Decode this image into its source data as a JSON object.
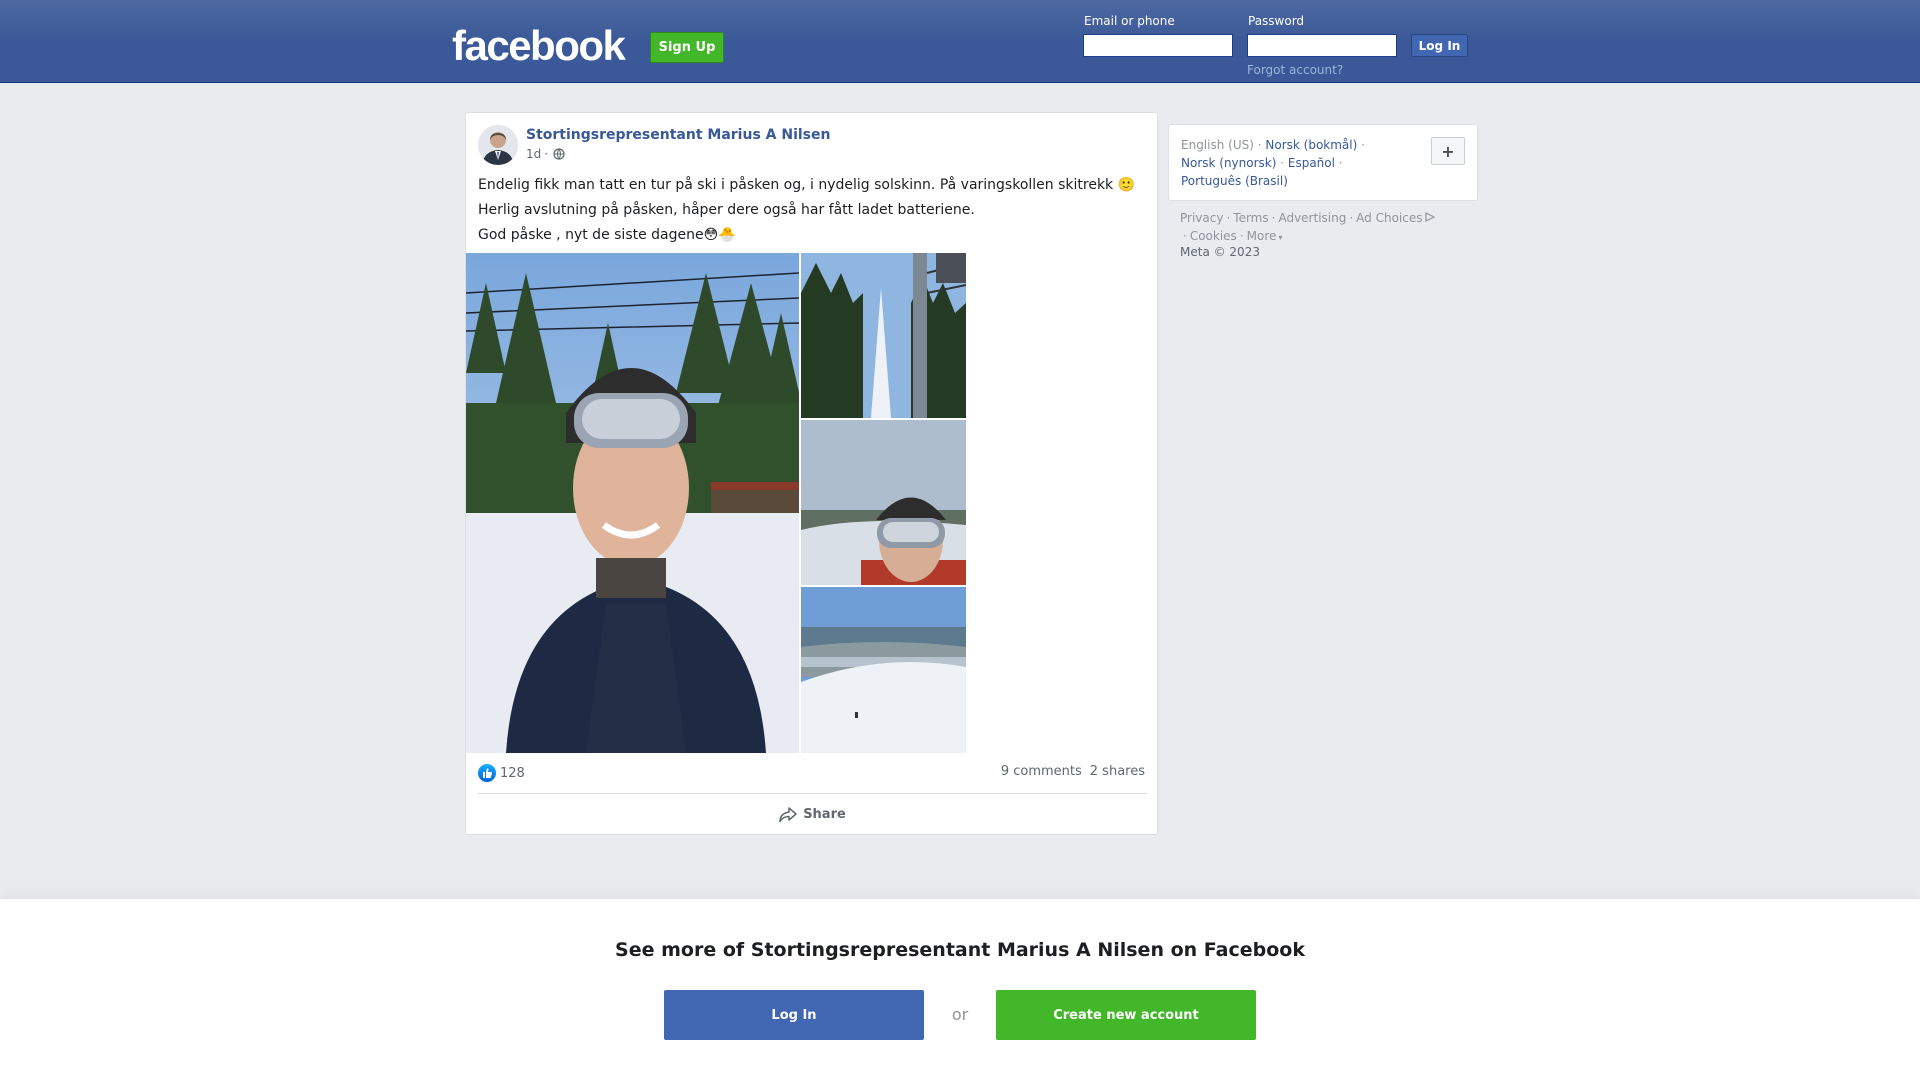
{
  "header": {
    "logo": "facebook",
    "signup_label": "Sign Up",
    "email_label": "Email or phone",
    "password_label": "Password",
    "login_label": "Log In",
    "forgot_label": "Forgot account?"
  },
  "post": {
    "author": "Stortingsrepresentant Marius A Nilsen",
    "time": "1d",
    "separator": "·",
    "privacy_icon": "globe-icon",
    "lines": [
      "Endelig fikk man tatt en tur på ski i påsken og, i nydelig solskinn. På varingskollen skitrekk 🙂",
      "Herlig avslutning på påsken, håper dere også har fått ladet batteriene.",
      "God påske , nyt de siste dagene😳🐣"
    ],
    "likes": "128",
    "comments": "9 comments",
    "shares": "2 shares",
    "share_label": "Share"
  },
  "sidebar": {
    "languages": [
      "English (US)",
      "Norsk (bokmål)",
      "Norsk (nynorsk)",
      "Español",
      "Português (Brasil)"
    ],
    "footer_links": [
      "Privacy",
      "Terms",
      "Advertising",
      "Ad Choices",
      "Cookies",
      "More"
    ],
    "copyright": "Meta © 2023"
  },
  "banner": {
    "title": "See more of Stortingsrepresentant Marius A Nilsen on Facebook",
    "login_label": "Log In",
    "or_label": "or",
    "create_label": "Create new account"
  },
  "colors": {
    "brand_blue": "#3b5998",
    "button_green": "#42b72a",
    "link_blue": "#385898"
  }
}
